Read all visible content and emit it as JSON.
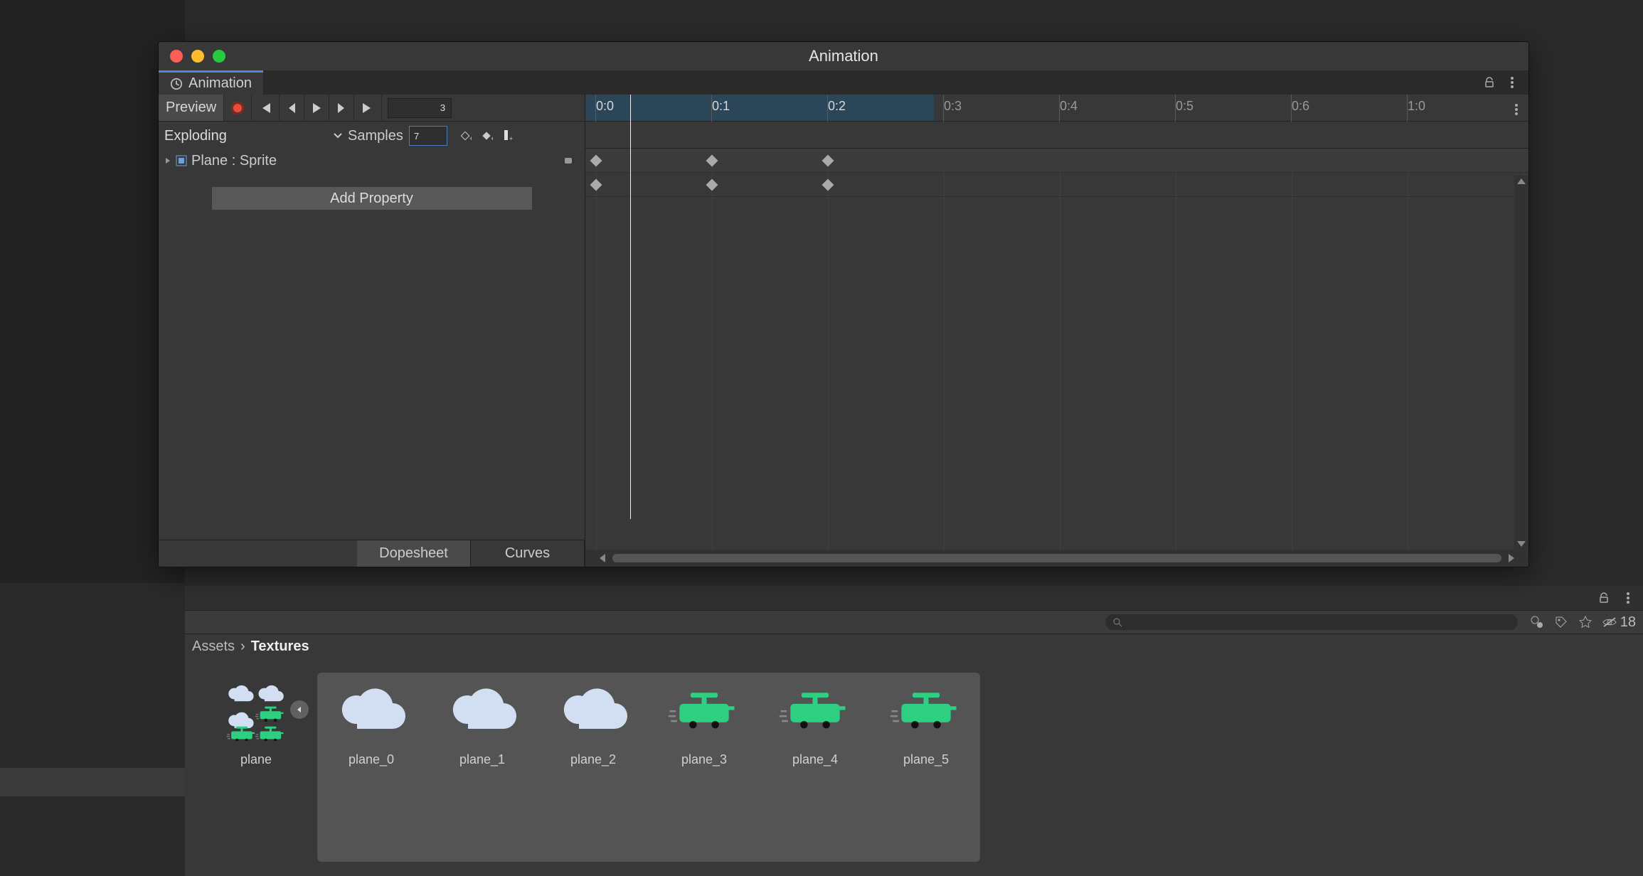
{
  "window": {
    "title": "Animation"
  },
  "tab": {
    "label": "Animation"
  },
  "toolbar": {
    "preview_label": "Preview",
    "frame_value": "3"
  },
  "clip": {
    "name": "Exploding",
    "samples_label": "Samples",
    "samples_value": "7"
  },
  "ruler": {
    "labels": [
      "0:0",
      "0:1",
      "0:2",
      "0:3",
      "0:4",
      "0:5",
      "0:6",
      "1:0"
    ],
    "shaded_until_index": 3
  },
  "property": {
    "row_label": "Plane : Sprite",
    "add_button": "Add Property"
  },
  "bottom_tabs": {
    "dopesheet": "Dopesheet",
    "curves": "Curves"
  },
  "breadcrumb": {
    "root": "Assets",
    "current": "Textures"
  },
  "hidden_count": "18",
  "search": {
    "placeholder": ""
  },
  "assets": [
    {
      "name": "plane",
      "type": "atlas"
    },
    {
      "name": "plane_0",
      "type": "cloud"
    },
    {
      "name": "plane_1",
      "type": "cloud"
    },
    {
      "name": "plane_2",
      "type": "cloud"
    },
    {
      "name": "plane_3",
      "type": "plane"
    },
    {
      "name": "plane_4",
      "type": "plane"
    },
    {
      "name": "plane_5",
      "type": "plane"
    }
  ]
}
